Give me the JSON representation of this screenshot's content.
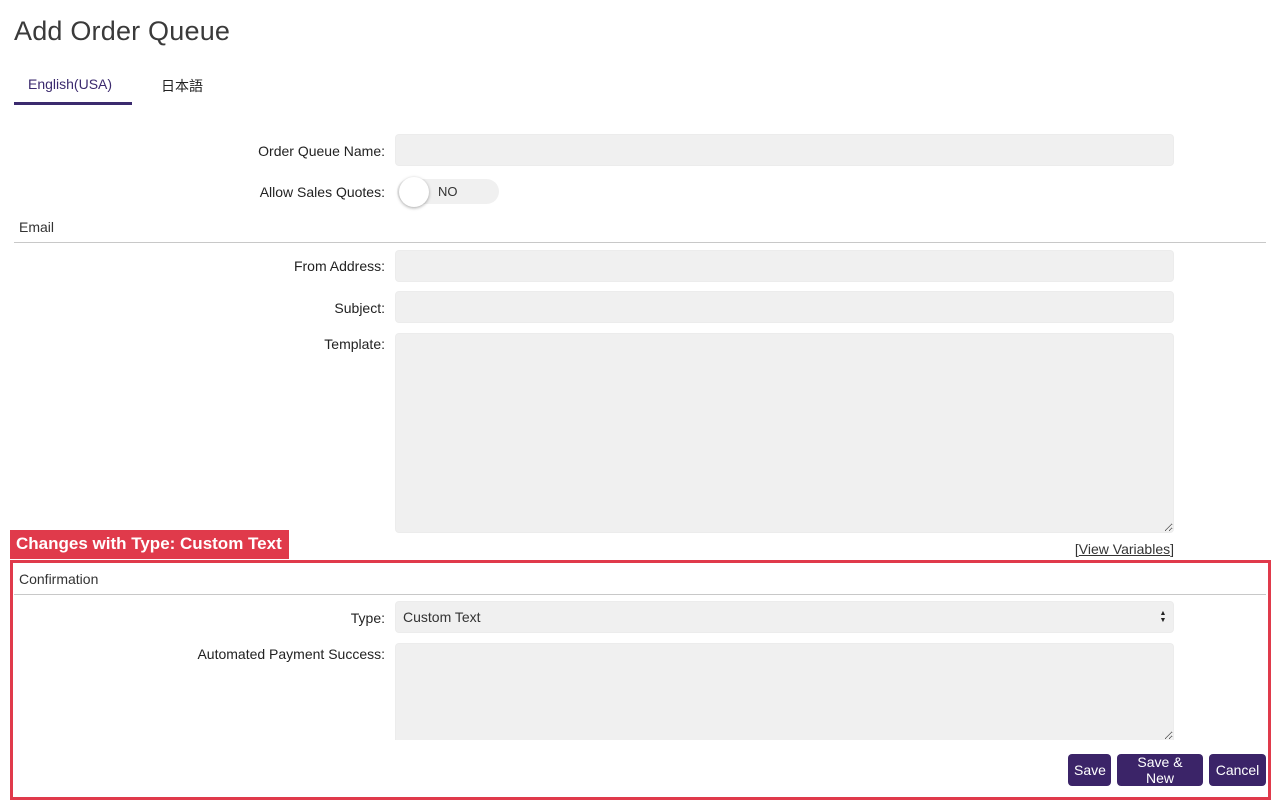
{
  "page": {
    "title": "Add Order Queue"
  },
  "tabs": [
    {
      "label": "English(USA)",
      "active": true
    },
    {
      "label": "日本語",
      "active": false
    }
  ],
  "form": {
    "order_queue_name": {
      "label": "Order Queue Name:",
      "value": ""
    },
    "allow_sales_quotes": {
      "label": "Allow Sales Quotes:",
      "value": "NO"
    },
    "email": {
      "section_title": "Email",
      "from_address": {
        "label": "From Address:",
        "value": ""
      },
      "subject": {
        "label": "Subject:",
        "value": ""
      },
      "template": {
        "label": "Template:",
        "value": ""
      },
      "view_variables": {
        "open": "[",
        "link": "View Variables",
        "close": "]"
      }
    },
    "confirmation": {
      "section_title": "Confirmation",
      "type": {
        "label": "Type:",
        "value": "Custom Text"
      },
      "automated_payment_success": {
        "label": "Automated Payment Success:",
        "value": ""
      }
    }
  },
  "annotation": {
    "label": "Changes with Type: Custom Text",
    "color": "#e03a4b"
  },
  "buttons": {
    "save": "Save",
    "save_new": "Save & New",
    "cancel": "Cancel"
  },
  "colors": {
    "accent": "#3b2468",
    "field_bg": "#f0f0f0"
  }
}
